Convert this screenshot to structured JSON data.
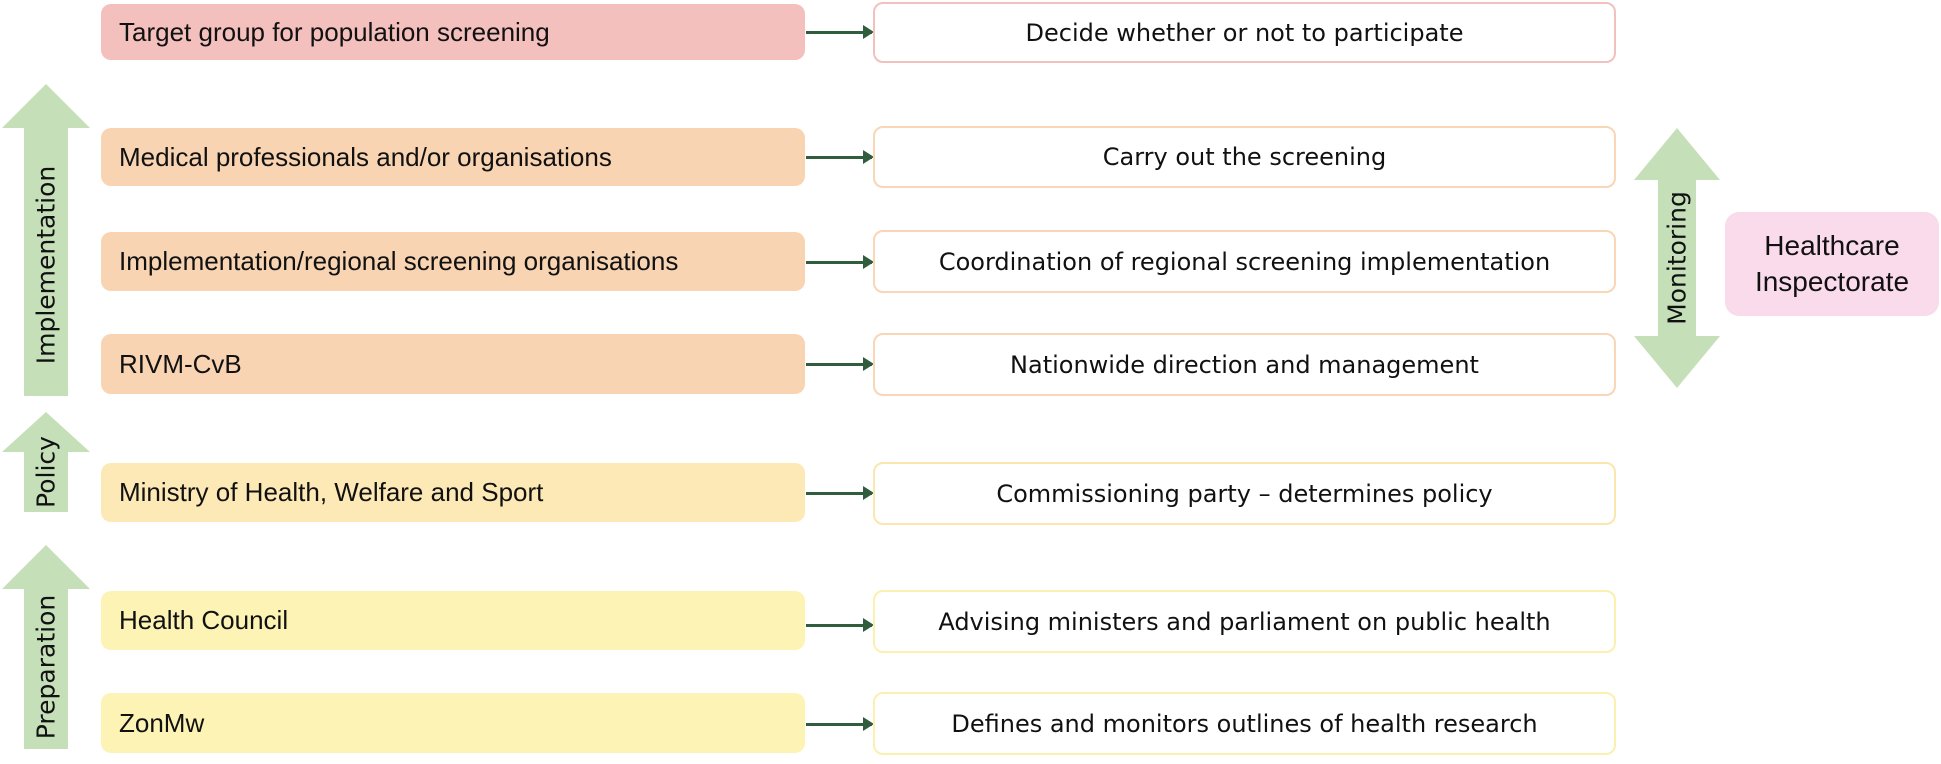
{
  "colors": {
    "target": "#f4c0bd",
    "implementation": "#f8d4b2",
    "policy": "#fde9b5",
    "preparation": "#fdf3b4",
    "arrow": "#c5dfb8",
    "inspectorate": "#fadbec",
    "connector": "#2f5d3d"
  },
  "rows": [
    {
      "actor": "Target group for population screening",
      "role": "Decide whether or not to participate"
    },
    {
      "actor": "Medical professionals and/or organisations",
      "role": "Carry out the screening"
    },
    {
      "actor": "Implementation/regional screening organisations",
      "role": "Coordination of regional screening implementation"
    },
    {
      "actor": "RIVM-CvB",
      "role": "Nationwide direction and management"
    },
    {
      "actor": "Ministry of Health, Welfare and Sport",
      "role": "Commissioning party – determines policy"
    },
    {
      "actor": "Health Council",
      "role": "Advising ministers and parliament on public health"
    },
    {
      "actor": "ZonMw",
      "role": "Defines and monitors outlines of health research"
    }
  ],
  "phases": {
    "implementation": "Implementation",
    "policy": "Policy",
    "preparation": "Preparation"
  },
  "monitoring": {
    "label": "Monitoring",
    "body_line1": "Healthcare",
    "body_line2": "Inspectorate"
  }
}
